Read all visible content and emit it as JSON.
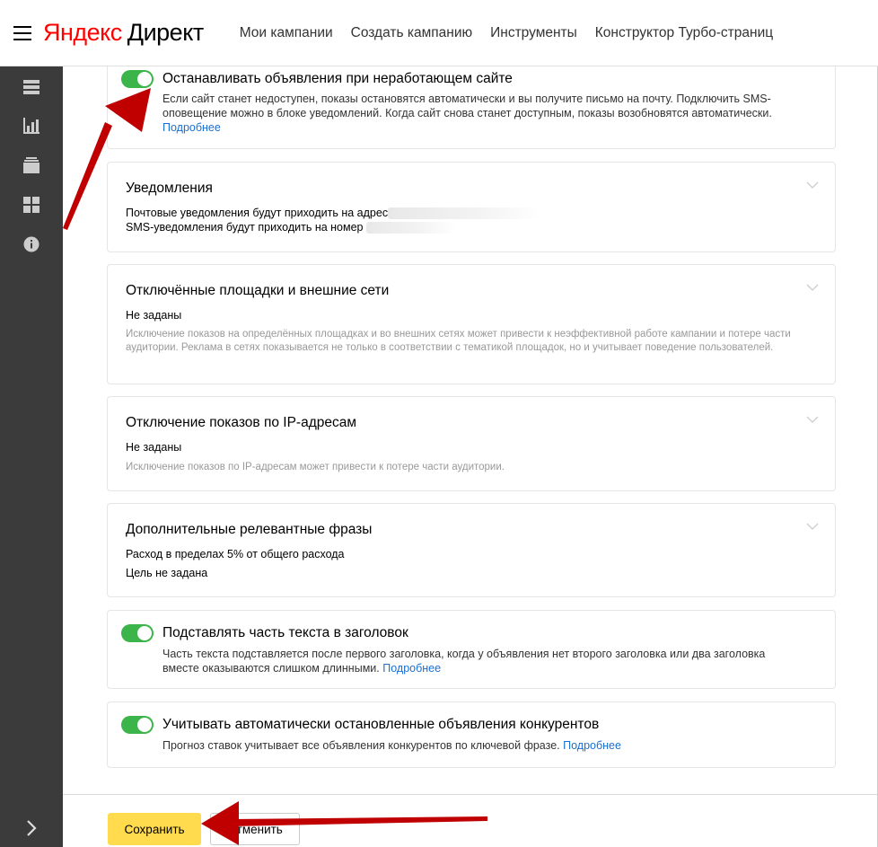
{
  "header": {
    "logo_yandex": "Яндекс",
    "logo_direct": "Директ",
    "nav": [
      "Мои кампании",
      "Создать кампанию",
      "Инструменты",
      "Конструктор Турбо-страниц"
    ]
  },
  "sidebar": {
    "icons": [
      "list-icon",
      "bar-chart-icon",
      "stack-icon",
      "grid-icon",
      "info-icon"
    ],
    "expand_icon": "chevron-right-icon"
  },
  "stop_ads": {
    "title": "Останавливать объявления при неработающем сайте",
    "desc": "Если сайт станет недоступен, показы остановятся автоматически и вы получите письмо на почту. Подключить SMS-оповещение можно в блоке уведомлений. Когда сайт снова станет доступным, показы возобновятся автоматически.",
    "link": "Подробнее",
    "enabled": true
  },
  "notifications": {
    "title": "Уведомления",
    "email_line": "Почтовые уведомления будут приходить на адрес",
    "sms_line": "SMS-уведомления будут приходить на номер"
  },
  "disabled_sites": {
    "title": "Отключённые площадки и внешние сети",
    "value": "Не заданы",
    "hint": "Исключение показов на определённых площадках и во внешних сетях может привести к неэффективной работе кампании и потере части аудитории. Реклама в сетях показывается не только в соответствии с тематикой площадок, но и учитывает поведение пользователей."
  },
  "ip_block": {
    "title": "Отключение показов по IP-адресам",
    "value": "Не заданы",
    "hint": "Исключение показов по IP-адресам может привести к потере части аудитории."
  },
  "extra_phrases": {
    "title": "Дополнительные релевантные фразы",
    "line1": "Расход в пределах 5% от общего расхода",
    "line2": "Цель не задана"
  },
  "substitute_text": {
    "title": "Подставлять часть текста в заголовок",
    "desc": "Часть текста подставляется после первого заголовка, когда у объявления нет второго заголовка или два заголовка вместе оказываются слишком длинными.",
    "link": "Подробнее",
    "enabled": true
  },
  "competitors": {
    "title": "Учитывать автоматически остановленные объявления конкурентов",
    "desc": "Прогноз ставок учитывает все объявления конкурентов по ключевой фразе.",
    "link": "Подробнее",
    "enabled": true
  },
  "footer": {
    "save": "Сохранить",
    "cancel": "Отменить"
  },
  "colors": {
    "toggle_on": "#3bb54a",
    "save_button": "#ffdb4d",
    "link": "#1a6fd1",
    "annotation_arrow": "#c00000",
    "logo_red": "#ff0000"
  }
}
